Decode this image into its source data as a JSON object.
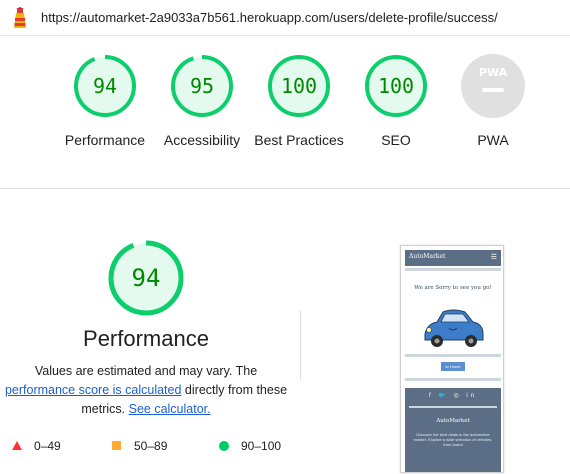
{
  "url": "https://automarket-2a9033a7b561.herokuapp.com/users/delete-profile/success/",
  "categories": [
    {
      "score": "94",
      "score_value": 94,
      "label": "Performance"
    },
    {
      "score": "95",
      "score_value": 95,
      "label": "Accessibility"
    },
    {
      "score": "100",
      "score_value": 100,
      "label": "Best Practices"
    },
    {
      "score": "100",
      "score_value": 100,
      "label": "SEO"
    },
    {
      "score": "",
      "score_value": null,
      "label": "PWA"
    }
  ],
  "pwa_badge": "PWA",
  "performance": {
    "score": "94",
    "score_value": 94,
    "title": "Performance",
    "desc_prefix": "Values are estimated and may vary. The",
    "desc_link": "performance score is calculated",
    "desc_middle": "directly from these metrics.",
    "desc_link2": "See calculator."
  },
  "legend": [
    {
      "range": "0–49",
      "shape": "triangle",
      "color": "#ff3333"
    },
    {
      "range": "50–89",
      "shape": "square",
      "color": "#ffaa33"
    },
    {
      "range": "90–100",
      "shape": "circle",
      "color": "#00cc66"
    }
  ],
  "screenshot": {
    "brand": "AutoMarket",
    "menu_icon": "hamburger-icon",
    "message": "We are Sorry to see you go!",
    "button": "to Home",
    "social": "f 🐦 ◎ in",
    "footer_title": "AutoMarket",
    "footer_text": "Discover the best deals in the automotive market. Explore a wide selection of vehicles, from brand"
  },
  "colors": {
    "pass": "#0cce6b",
    "pass_text": "#008800",
    "pass_fill": "#e5faef",
    "pwa_gray": "#e0e0e0"
  }
}
